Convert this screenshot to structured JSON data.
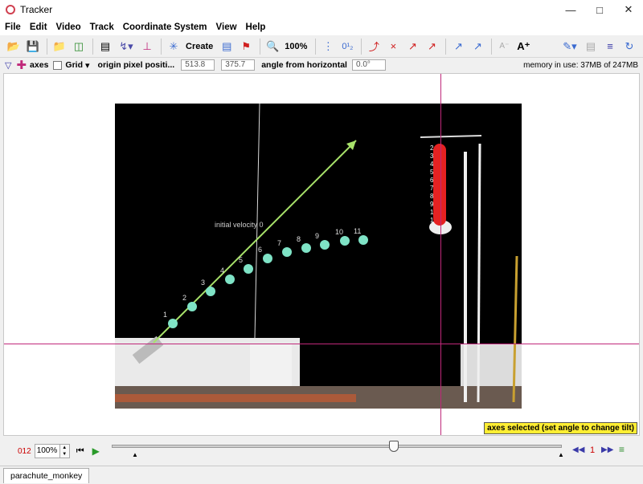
{
  "window": {
    "title": "Tracker"
  },
  "menu": [
    "File",
    "Edit",
    "Video",
    "Track",
    "Coordinate System",
    "View",
    "Help"
  ],
  "toolbar": {
    "create_label": "Create",
    "zoom_label": "100%"
  },
  "axes_bar": {
    "axes_label": "axes",
    "grid_label": "Grid",
    "origin_label": "origin pixel positi...",
    "origin_x": "513.8",
    "origin_y": "375.7",
    "angle_label": "angle from horizontal",
    "angle_value": "0.0°",
    "memory": "memory in use: 37MB of 247MB"
  },
  "video": {
    "velocity_label": "initial velocity 0",
    "green_track": {
      "labels": [
        "1",
        "2",
        "3",
        "4",
        "5",
        "6",
        "7",
        "8",
        "9",
        "10",
        "11"
      ]
    },
    "red_track_labels": [
      "2",
      "3",
      "4",
      "5",
      "6",
      "7",
      "8",
      "9",
      "1",
      "1"
    ]
  },
  "status": {
    "tooltip": "axes selected (set angle to change tilt)"
  },
  "player": {
    "frame": "012",
    "zoom": "100%",
    "step_count": "1",
    "position_fraction": 0.63
  },
  "tabs": [
    "parachute_monkey"
  ],
  "colors": {
    "accent_axis": "#c0287a",
    "green_track": "#7fe3c6",
    "red_track": "#e52222",
    "vector": "#a8e26a"
  }
}
